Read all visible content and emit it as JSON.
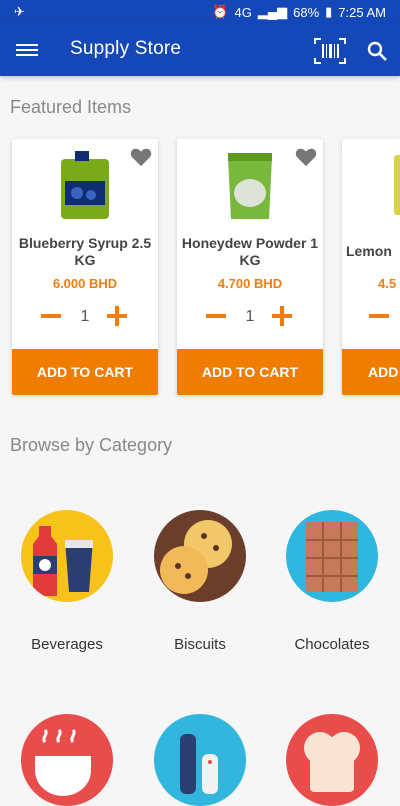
{
  "status": {
    "battery": "68%",
    "time": "7:25 AM",
    "network": "4G"
  },
  "app": {
    "title": "Supply Store"
  },
  "sections": {
    "featured": "Featured Items",
    "browse": "Browse by Category"
  },
  "products": [
    {
      "name": "Blueberry Syrup 2.5 KG",
      "price": "6.000 BHD",
      "qty": "1",
      "button": "ADD TO CART"
    },
    {
      "name": "Honeydew Powder 1 KG",
      "price": "4.700 BHD",
      "qty": "1",
      "button": "ADD TO CART"
    },
    {
      "name": "Lemon",
      "price": "4.5",
      "button": "ADD"
    }
  ],
  "categories": [
    {
      "label": "Beverages",
      "color": "#f7c21a"
    },
    {
      "label": "Biscuits",
      "color": "#6b3d2b"
    },
    {
      "label": "Chocolates",
      "color": "#30b7df"
    },
    {
      "label": "",
      "color": "#e84d4b"
    },
    {
      "label": "",
      "color": "#33b6dd"
    },
    {
      "label": "",
      "color": "#e84d4b"
    }
  ],
  "colors": {
    "primary": "#1447b8",
    "accent": "#f07c00"
  }
}
